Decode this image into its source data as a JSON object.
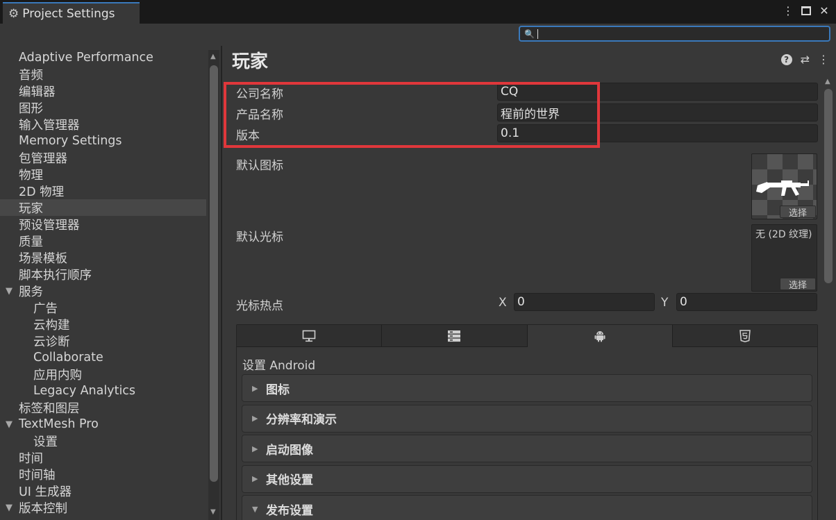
{
  "window": {
    "tab_title": "Project Settings",
    "tab_icon": "gear-icon",
    "more_icon": "⋮",
    "maximize_icon": "maximize-icon",
    "close_icon": "✕"
  },
  "search": {
    "value": "",
    "icon": "🔍"
  },
  "sidebar": {
    "items": [
      {
        "label": "Adaptive Performance",
        "indent": 0
      },
      {
        "label": "音频",
        "indent": 0
      },
      {
        "label": "编辑器",
        "indent": 0
      },
      {
        "label": "图形",
        "indent": 0
      },
      {
        "label": "输入管理器",
        "indent": 0
      },
      {
        "label": "Memory Settings",
        "indent": 0
      },
      {
        "label": "包管理器",
        "indent": 0
      },
      {
        "label": "物理",
        "indent": 0
      },
      {
        "label": "2D 物理",
        "indent": 0
      },
      {
        "label": "玩家",
        "indent": 0,
        "selected": true
      },
      {
        "label": "预设管理器",
        "indent": 0
      },
      {
        "label": "质量",
        "indent": 0
      },
      {
        "label": "场景模板",
        "indent": 0
      },
      {
        "label": "脚本执行顺序",
        "indent": 0
      },
      {
        "label": "服务",
        "indent": 0,
        "expanded": true
      },
      {
        "label": "广告",
        "indent": 1
      },
      {
        "label": "云构建",
        "indent": 1
      },
      {
        "label": "云诊断",
        "indent": 1
      },
      {
        "label": "Collaborate",
        "indent": 1
      },
      {
        "label": "应用内购",
        "indent": 1
      },
      {
        "label": "Legacy Analytics",
        "indent": 1
      },
      {
        "label": "标签和图层",
        "indent": 0
      },
      {
        "label": "TextMesh Pro",
        "indent": 0,
        "expanded": true
      },
      {
        "label": "设置",
        "indent": 1
      },
      {
        "label": "时间",
        "indent": 0
      },
      {
        "label": "时间轴",
        "indent": 0
      },
      {
        "label": "UI 生成器",
        "indent": 0
      },
      {
        "label": "版本控制",
        "indent": 0,
        "expanded": true
      }
    ]
  },
  "main": {
    "title": "玩家",
    "company_label": "公司名称",
    "company_value": "CQ",
    "product_label": "产品名称",
    "product_value": "程前的世界",
    "version_label": "版本",
    "version_value": "0.1",
    "default_icon_label": "默认图标",
    "default_cursor_label": "默认光标",
    "cursor_none_text": "无 (2D 纹理)",
    "select_label": "选择",
    "hotspot_label": "光标热点",
    "hotspot_x_label": "X",
    "hotspot_x_value": "0",
    "hotspot_y_label": "Y",
    "hotspot_y_value": "0",
    "platform_tabs": [
      {
        "icon": "desktop-icon",
        "active": false
      },
      {
        "icon": "server-icon",
        "active": false
      },
      {
        "icon": "android-icon",
        "active": true
      },
      {
        "icon": "html5-icon",
        "active": false
      }
    ],
    "platform_title": "设置 Android",
    "sections": [
      {
        "label": "图标",
        "expanded": false
      },
      {
        "label": "分辨率和演示",
        "expanded": false
      },
      {
        "label": "启动图像",
        "expanded": false
      },
      {
        "label": "其他设置",
        "expanded": false
      },
      {
        "label": "发布设置",
        "expanded": true
      }
    ]
  },
  "colors": {
    "accent": "#3a79bb",
    "highlight_box": "#e0373b",
    "background": "#383838"
  }
}
